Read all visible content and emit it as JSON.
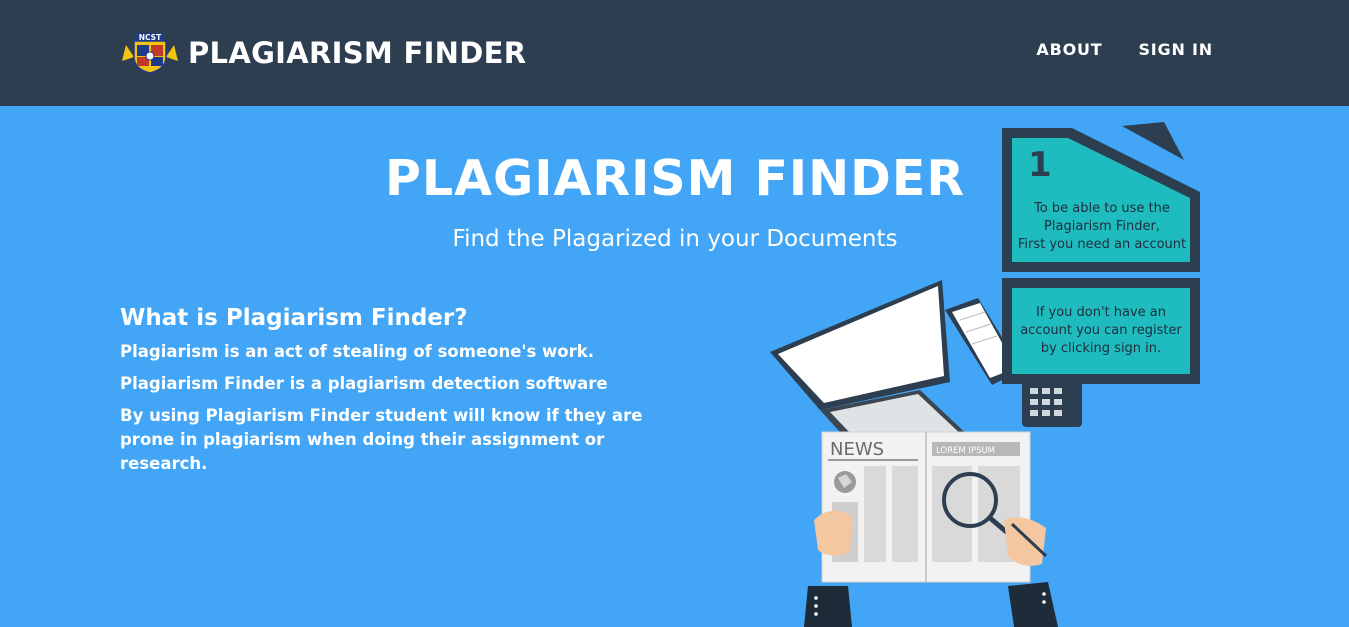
{
  "navbar": {
    "brand_logo_text": "NCST",
    "brand_name": "PLAGIARISM FINDER",
    "links": [
      {
        "label": "ABOUT"
      },
      {
        "label": "SIGN IN"
      }
    ]
  },
  "hero": {
    "title": "PLAGIARISM FINDER",
    "subtitle": "Find the Plagarized in your Documents"
  },
  "about": {
    "heading": "What is Plagiarism Finder?",
    "lines": [
      "Plagiarism is an act of stealing of someone's work.",
      "Plagiarism Finder is a plagiarism detection software",
      "By using Plagiarism Finder student will know if they are prone in plagiarism when doing their assignment or research."
    ]
  },
  "illustration": {
    "step_number": "1",
    "bubble_one": [
      "To be able to use the",
      "Plagiarism Finder,",
      "First you need an account"
    ],
    "bubble_two": [
      "If you don't have an",
      "account you can register",
      "by clicking sign in."
    ],
    "newspaper_title": "NEWS",
    "newspaper_header": "LOREM IPSUM"
  },
  "colors": {
    "navbar": "#2c3e50",
    "hero_background": "#42a5f5",
    "bubble_fill": "#1fbcbf",
    "bubble_border": "#2c3e50"
  }
}
